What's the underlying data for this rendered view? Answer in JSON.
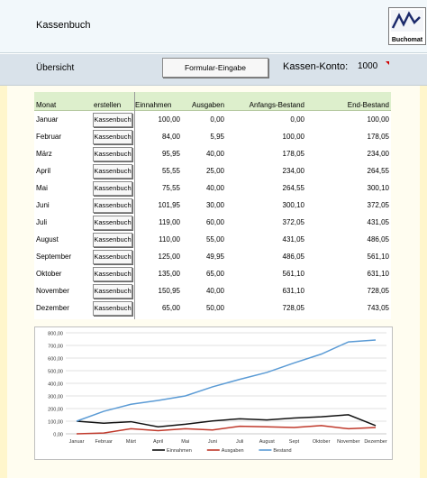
{
  "header": {
    "title": "Kassenbuch",
    "logo_text": "Buchomat",
    "logo_icon": "chart-logo-icon"
  },
  "toolbar": {
    "overview_label": "Übersicht",
    "form_button_label": "Formular-Eingabe",
    "account_label": "Kassen-Konto:",
    "account_value": "1000",
    "flag_color": "#d00000"
  },
  "table": {
    "headers": {
      "month": "Monat",
      "create": "erstellen",
      "income": "Einnahmen",
      "expenses": "Ausgaben",
      "start_balance": "Anfangs-Bestand",
      "end_balance": "End-Bestand"
    },
    "row_button_label": "Kassenbuch",
    "rows": [
      {
        "month": "Januar",
        "income": "100,00",
        "expenses": "0,00",
        "start": "0,00",
        "end": "100,00"
      },
      {
        "month": "Februar",
        "income": "84,00",
        "expenses": "5,95",
        "start": "100,00",
        "end": "178,05"
      },
      {
        "month": "März",
        "income": "95,95",
        "expenses": "40,00",
        "start": "178,05",
        "end": "234,00"
      },
      {
        "month": "April",
        "income": "55,55",
        "expenses": "25,00",
        "start": "234,00",
        "end": "264,55"
      },
      {
        "month": "Mai",
        "income": "75,55",
        "expenses": "40,00",
        "start": "264,55",
        "end": "300,10"
      },
      {
        "month": "Juni",
        "income": "101,95",
        "expenses": "30,00",
        "start": "300,10",
        "end": "372,05"
      },
      {
        "month": "Juli",
        "income": "119,00",
        "expenses": "60,00",
        "start": "372,05",
        "end": "431,05"
      },
      {
        "month": "August",
        "income": "110,00",
        "expenses": "55,00",
        "start": "431,05",
        "end": "486,05"
      },
      {
        "month": "September",
        "income": "125,00",
        "expenses": "49,95",
        "start": "486,05",
        "end": "561,10"
      },
      {
        "month": "Oktober",
        "income": "135,00",
        "expenses": "65,00",
        "start": "561,10",
        "end": "631,10"
      },
      {
        "month": "November",
        "income": "150,95",
        "expenses": "40,00",
        "start": "631,10",
        "end": "728,05"
      },
      {
        "month": "Dezember",
        "income": "65,00",
        "expenses": "50,00",
        "start": "728,05",
        "end": "743,05"
      }
    ]
  },
  "chart_data": {
    "type": "line",
    "categories": [
      "Januar",
      "Februar",
      "März",
      "April",
      "Mai",
      "Juni",
      "Juli",
      "August",
      "September",
      "Oktober",
      "November",
      "Dezember"
    ],
    "tick_labels": [
      "Januar",
      "Februar",
      "Märt",
      "April",
      "Mai",
      "Juni",
      "Juli",
      "August",
      "Sept",
      "Oktober",
      "November",
      "Dezember"
    ],
    "series": [
      {
        "name": "Einnahmen",
        "color": "#111111",
        "values": [
          100,
          84,
          95.95,
          55.55,
          75.55,
          101.95,
          119,
          110,
          125,
          135,
          150.95,
          65
        ]
      },
      {
        "name": "Ausgaben",
        "color": "#c0392b",
        "values": [
          0,
          5.95,
          40,
          25,
          40,
          30,
          60,
          55,
          49.95,
          65,
          40,
          50
        ]
      },
      {
        "name": "Bestand",
        "color": "#5b9bd5",
        "values": [
          100,
          178.05,
          234,
          264.55,
          300.1,
          372.05,
          431.05,
          486.05,
          561.1,
          631.1,
          728.05,
          743.05
        ]
      }
    ],
    "y_ticks": [
      "0,00",
      "100,00",
      "200,00",
      "300,00",
      "400,00",
      "500,00",
      "600,00",
      "700,00",
      "800,00"
    ],
    "ylim": [
      0,
      800
    ],
    "grid": true,
    "legend_position": "bottom"
  }
}
